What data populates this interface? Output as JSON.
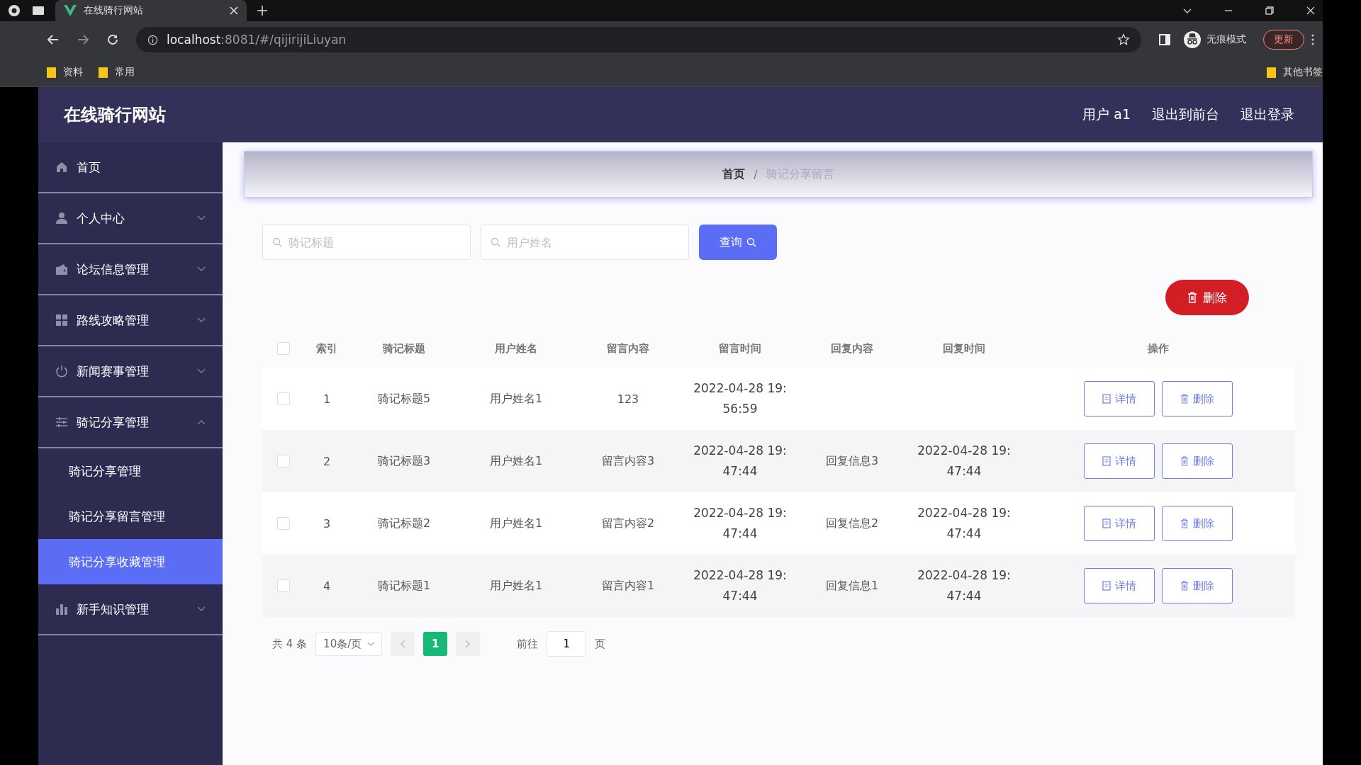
{
  "browser": {
    "tabs": [
      {
        "title": "在线骑行网站",
        "selected": true
      }
    ],
    "url_host": "localhost",
    "url_rest": ":8081/#/qijirijiLiuyan",
    "incognito": "无痕模式",
    "update": "更新",
    "bookmarks": [
      "资料",
      "常用"
    ],
    "other_bookmarks": "其他书签"
  },
  "app": {
    "title": "在线骑行网站",
    "header_links": [
      "用户 a1",
      "退出到前台",
      "退出登录"
    ]
  },
  "sidebar": {
    "items": [
      {
        "kind": "link",
        "label": "首页",
        "selected": false
      },
      {
        "kind": "group",
        "label": "个人中心",
        "expanded": false,
        "selected": false
      },
      {
        "kind": "group",
        "label": "论坛信息管理",
        "expanded": false,
        "selected": false
      },
      {
        "kind": "group",
        "label": "路线攻略管理",
        "expanded": false,
        "selected": false
      },
      {
        "kind": "group",
        "label": "新闻赛事管理",
        "expanded": false,
        "selected": false
      },
      {
        "kind": "group",
        "label": "骑记分享管理",
        "expanded": true,
        "selected": false,
        "children": [
          {
            "label": "骑记分享管理",
            "selected": false
          },
          {
            "label": "骑记分享留言管理",
            "selected": false
          },
          {
            "label": "骑记分享收藏管理",
            "selected": true
          }
        ]
      },
      {
        "kind": "group",
        "label": "新手知识管理",
        "expanded": false,
        "selected": false
      }
    ]
  },
  "breadcrumb": [
    "首页",
    "骑记分享留言"
  ],
  "breadcrumb_separator": "/",
  "search": {
    "fields": [
      {
        "placeholder": "骑记标题"
      },
      {
        "placeholder": "用户姓名"
      }
    ],
    "button": "查询"
  },
  "delete_button": "删除",
  "table": {
    "all_checked": false,
    "columns": [
      "索引",
      "骑记标题",
      "用户姓名",
      "留言内容",
      "留言时间",
      "回复内容",
      "回复时间",
      "操作"
    ],
    "rows": [
      {
        "checked": false,
        "index": "1",
        "title": "骑记标题5",
        "user": "用户姓名1",
        "content": "123",
        "time": "2022-04-28 19:56:59",
        "actions": [
          "详情",
          "删除"
        ]
      },
      {
        "checked": false,
        "index": "2",
        "title": "骑记标题3",
        "user": "用户姓名1",
        "content": "留言内容3",
        "time": "2022-04-28 19:47:44",
        "reply": "回复信息3",
        "reply_time": "2022-04-28 19:47:44",
        "actions": [
          "详情",
          "删除"
        ]
      },
      {
        "checked": false,
        "index": "3",
        "title": "骑记标题2",
        "user": "用户姓名1",
        "content": "留言内容2",
        "time": "2022-04-28 19:47:44",
        "reply": "回复信息2",
        "reply_time": "2022-04-28 19:47:44",
        "actions": [
          "详情",
          "删除"
        ]
      },
      {
        "checked": false,
        "index": "4",
        "title": "骑记标题1",
        "user": "用户姓名1",
        "content": "留言内容1",
        "time": "2022-04-28 19:47:44",
        "reply": "回复信息1",
        "reply_time": "2022-04-28 19:47:44",
        "actions": [
          "详情",
          "删除"
        ]
      }
    ]
  },
  "pagination": {
    "total": "共 4 条",
    "page_size": "10条/页",
    "pages": [
      {
        "label": "1",
        "selected": true
      }
    ],
    "goto": "前往",
    "goto_value": "1",
    "goto_suffix": "页"
  }
}
